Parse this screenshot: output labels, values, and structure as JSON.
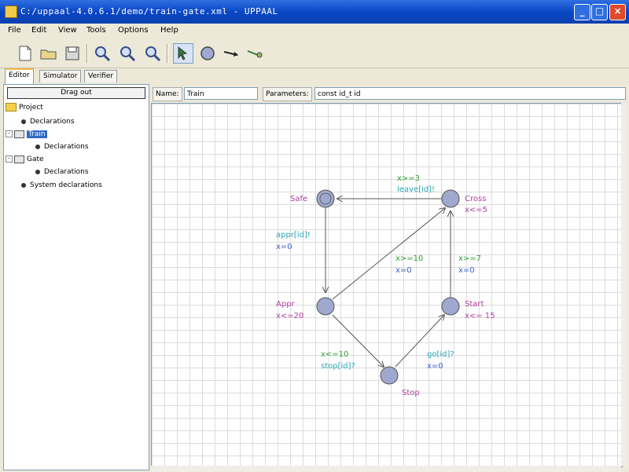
{
  "window": {
    "title": "C:/uppaal-4.0.6.1/demo/train-gate.xml - UPPAAL"
  },
  "menu": [
    "File",
    "Edit",
    "View",
    "Tools",
    "Options",
    "Help"
  ],
  "tabs": [
    "Editor",
    "Simulator",
    "Verifier"
  ],
  "tree": {
    "drag_out": "Drag out",
    "project": "Project",
    "items": [
      "Declarations",
      "Train",
      "Declarations",
      "Gate",
      "Declarations",
      "System declarations"
    ]
  },
  "editor": {
    "name_label": "Name:",
    "name_value": "Train",
    "params_label": "Parameters:",
    "params_value": "const id_t id"
  },
  "automaton": {
    "locations": {
      "safe": "Safe",
      "cross": "Cross",
      "cross_inv": "x<=5",
      "appr": "Appr",
      "appr_inv": "x<=20",
      "start": "Start",
      "start_inv": "x<= 15",
      "stop": "Stop"
    },
    "edges": {
      "cross_safe_guard": "x>=3",
      "cross_safe_sync": "leave[id]!",
      "safe_appr_sync": "appr[id]!",
      "safe_appr_update": "x=0",
      "appr_cross_guard": "x>=10",
      "appr_cross_update": "x=0",
      "start_cross_guard": "x>=7",
      "start_cross_update": "x=0",
      "appr_stop_guard": "x<=10",
      "appr_stop_sync": "stop[id]?",
      "stop_start_sync": "go[id]?",
      "stop_start_update": "x=0"
    },
    "colors": {
      "name": "#b0409e",
      "guard": "#2fa02f",
      "sync": "#2aa6b8",
      "update": "#3a5fd0",
      "location": "#9fa8cf"
    }
  }
}
